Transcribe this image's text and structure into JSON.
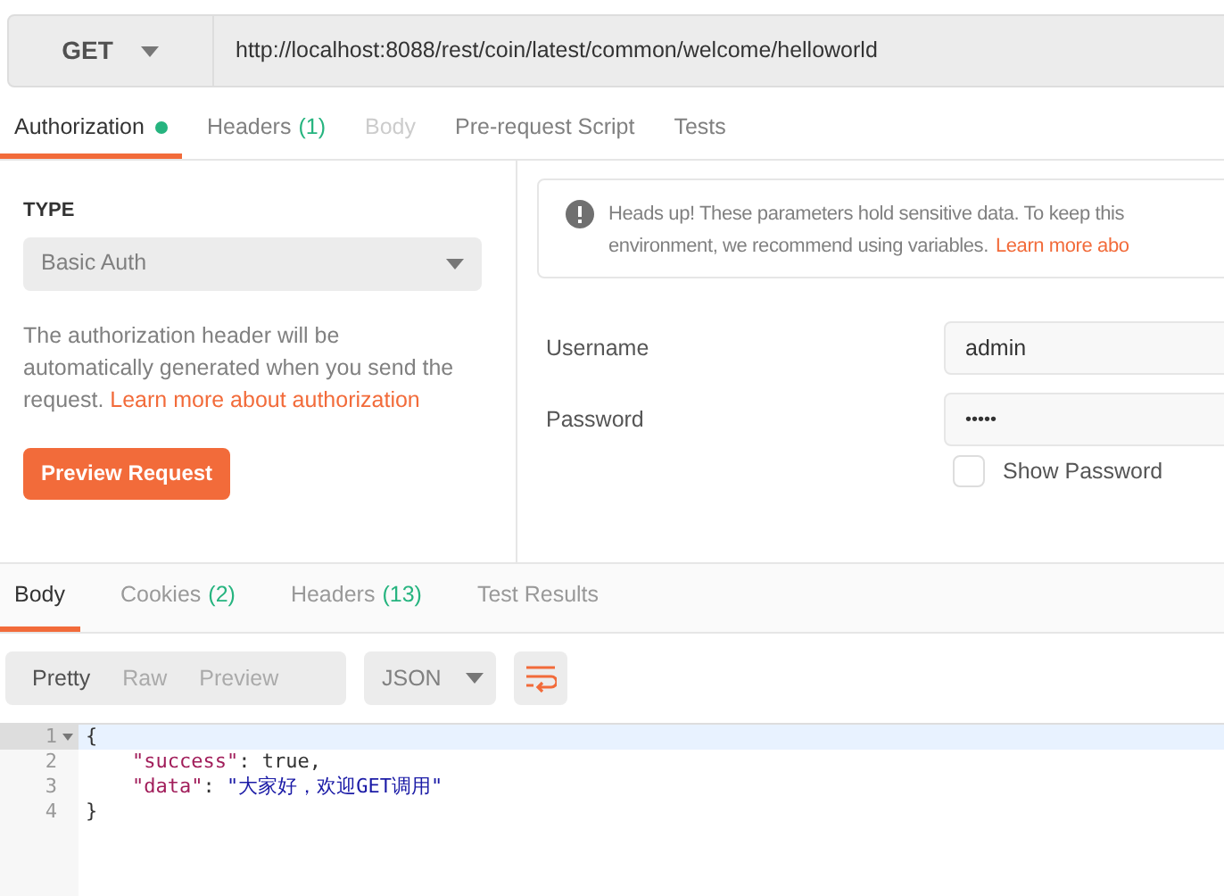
{
  "request": {
    "method": "GET",
    "url": "http://localhost:8088/rest/coin/latest/common/welcome/helloworld"
  },
  "request_tabs": [
    {
      "label": "Authorization",
      "dot": true,
      "disabled": false,
      "selected": true
    },
    {
      "label": "Headers",
      "count": "(1)",
      "dot": false,
      "disabled": false,
      "selected": false
    },
    {
      "label": "Body",
      "dot": false,
      "disabled": true,
      "selected": false
    },
    {
      "label": "Pre-request Script",
      "dot": false,
      "disabled": false,
      "selected": false
    },
    {
      "label": "Tests",
      "dot": false,
      "disabled": false,
      "selected": false
    }
  ],
  "auth": {
    "type_label": "TYPE",
    "type_value": "Basic Auth",
    "description": "The authorization header will be automatically generated when you send the request.",
    "description_link": "Learn more about authorization",
    "preview_button": "Preview Request"
  },
  "notice": {
    "line_1": "Heads up! These parameters hold sensitive data. To keep this",
    "line_2": "environment, we recommend using variables.",
    "link": "Learn more abo"
  },
  "credentials": {
    "username_label": "Username",
    "username": "admin",
    "password_label": "Password",
    "password": "•••••",
    "show_password": {
      "label": "Show Password",
      "checked": false
    }
  },
  "response_tabs": [
    {
      "label": "Body",
      "selected": true
    },
    {
      "label": "Cookies",
      "count": "(2)",
      "selected": false
    },
    {
      "label": "Headers",
      "count": "(13)",
      "selected": false
    },
    {
      "label": "Test Results",
      "selected": false
    }
  ],
  "view_modes": [
    {
      "label": "Pretty",
      "selected": true
    },
    {
      "label": "Raw",
      "selected": false
    },
    {
      "label": "Preview",
      "selected": false
    }
  ],
  "format": "JSON",
  "code_lines": [
    {
      "number": "1",
      "foldable": true,
      "highlighted": true,
      "indent": false,
      "tokens": [
        {
          "kind": "punct",
          "text": "{"
        }
      ]
    },
    {
      "number": "2",
      "foldable": false,
      "highlighted": false,
      "indent": true,
      "tokens": [
        {
          "kind": "key",
          "text": "\"success\""
        },
        {
          "kind": "punct",
          "text": ": "
        },
        {
          "kind": "literal",
          "text": "true"
        },
        {
          "kind": "punct",
          "text": ","
        }
      ]
    },
    {
      "number": "3",
      "foldable": false,
      "highlighted": false,
      "indent": true,
      "tokens": [
        {
          "kind": "key",
          "text": "\"data\""
        },
        {
          "kind": "punct",
          "text": ": "
        },
        {
          "kind": "string",
          "text": "\"大家好，欢迎GET调用\""
        }
      ]
    },
    {
      "number": "4",
      "foldable": false,
      "highlighted": false,
      "indent": false,
      "tokens": [
        {
          "kind": "punct",
          "text": "}"
        }
      ]
    }
  ]
}
